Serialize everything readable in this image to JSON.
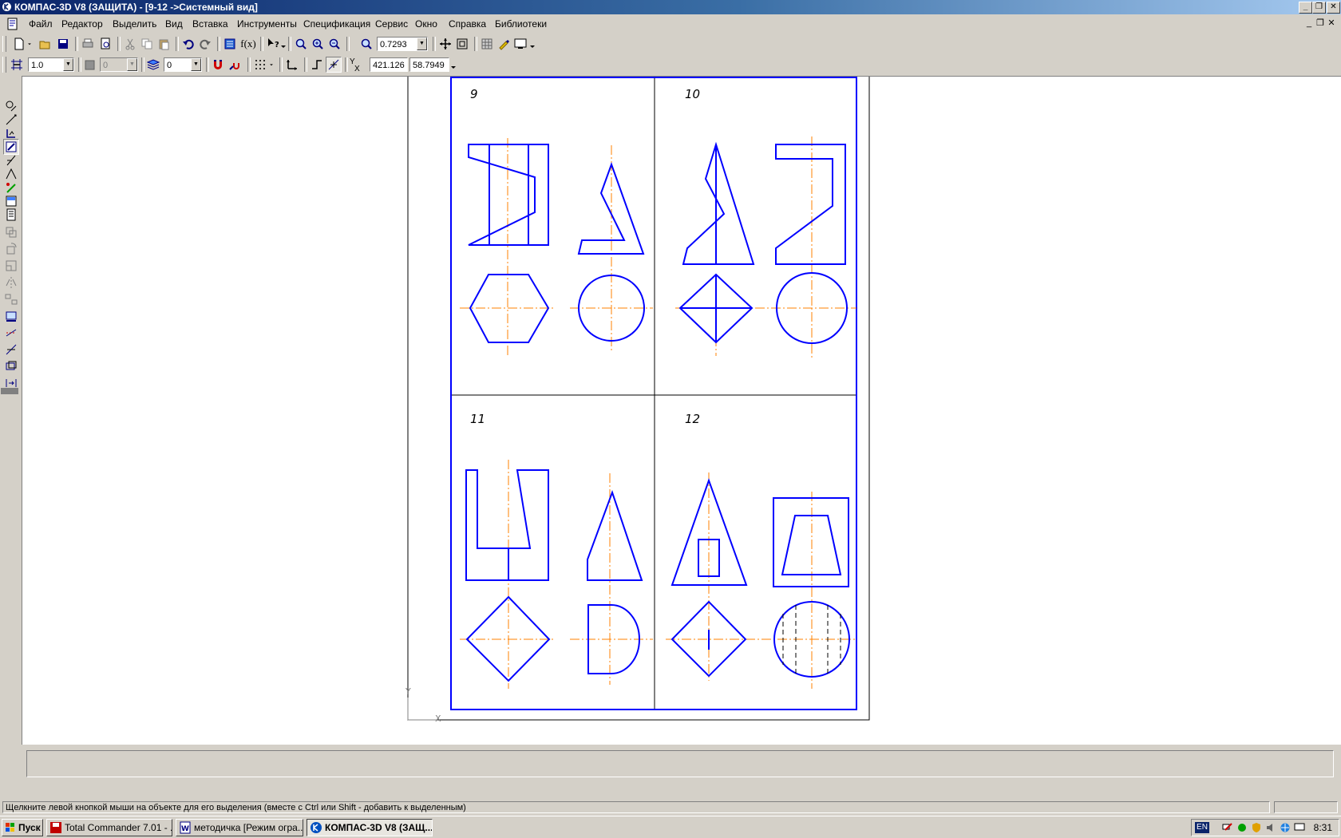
{
  "window": {
    "title": "КОМПАС-3D V8 (ЗАЩИТА) - [9-12 ->Системный вид]",
    "caption_buttons": [
      "_",
      "❐",
      "✕"
    ],
    "mdi_buttons": [
      "_",
      "❐",
      "✕"
    ]
  },
  "menu": [
    "Файл",
    "Редактор",
    "Выделить",
    "Вид",
    "Вставка",
    "Инструменты",
    "Спецификация",
    "Сервис",
    "Окно",
    "Справка",
    "Библиотеки"
  ],
  "toolbar": {
    "zoom_value": "0.7293",
    "fx_label": "f(x)",
    "step_value": "1.0",
    "style_value": "0",
    "layer_value": "0",
    "coord_x": "421.126",
    "coord_y": "58.7949",
    "coord_label": "Y",
    "coord_sublabel": "X"
  },
  "drawing": {
    "labels": [
      "9",
      "10",
      "11",
      "12"
    ],
    "axis_x": "X",
    "axis_y": "Y",
    "colors": {
      "contour": "#0000ff",
      "axis": "#ff8000",
      "frame": "#000000"
    }
  },
  "statusbar": {
    "hint": "Щелкните левой кнопкой мыши на объекте для его выделения (вместе с Ctrl или Shift - добавить к выделенным)"
  },
  "taskbar": {
    "start": "Пуск",
    "tasks": [
      "Total Commander 7.01 - ...",
      "методичка [Режим огра...",
      "КОМПАС-3D V8 (ЗАЩ..."
    ],
    "lang": "EN",
    "clock": "8:31"
  }
}
